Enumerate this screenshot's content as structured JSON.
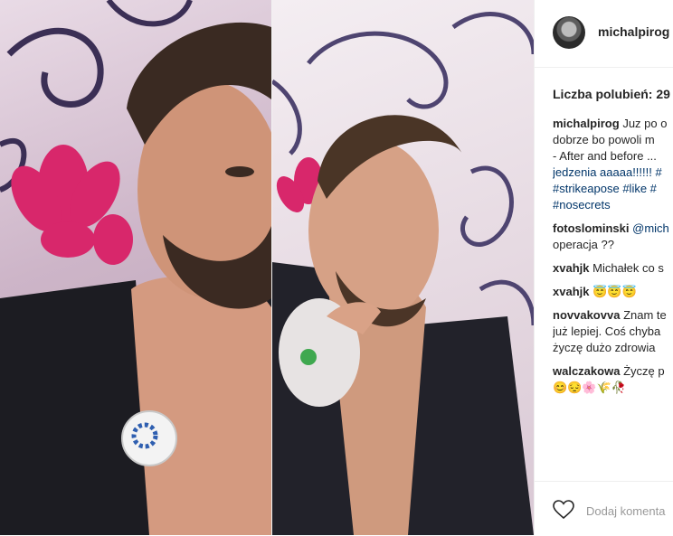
{
  "post": {
    "username": "michalpirog",
    "likes_label": "Liczba polubień: 29"
  },
  "caption": {
    "user": "michalpirog",
    "lines": [
      "Juz po o",
      "dobrze bo powoli m",
      "- After and before ...",
      "jedzenia aaaaa!!!!!! #",
      "#strikeapose #like #",
      "#nosecrets"
    ]
  },
  "comments": [
    {
      "user": "fotoslominski",
      "lines": [
        "@mich",
        "operacja ??"
      ]
    },
    {
      "user": "xvahjk",
      "lines": [
        "Michałek co s"
      ]
    },
    {
      "user": "xvahjk",
      "lines": [
        "😇😇😇"
      ]
    },
    {
      "user": "novvakovva",
      "lines": [
        "Znam te",
        "już lepiej. Coś chyba",
        "życzę dużo zdrowia"
      ]
    },
    {
      "user": "walczakowa",
      "lines": [
        "Życzę p",
        "😊😔🌸🌾🥀"
      ]
    }
  ],
  "footer": {
    "add_comment_placeholder": "Dodaj komenta"
  }
}
